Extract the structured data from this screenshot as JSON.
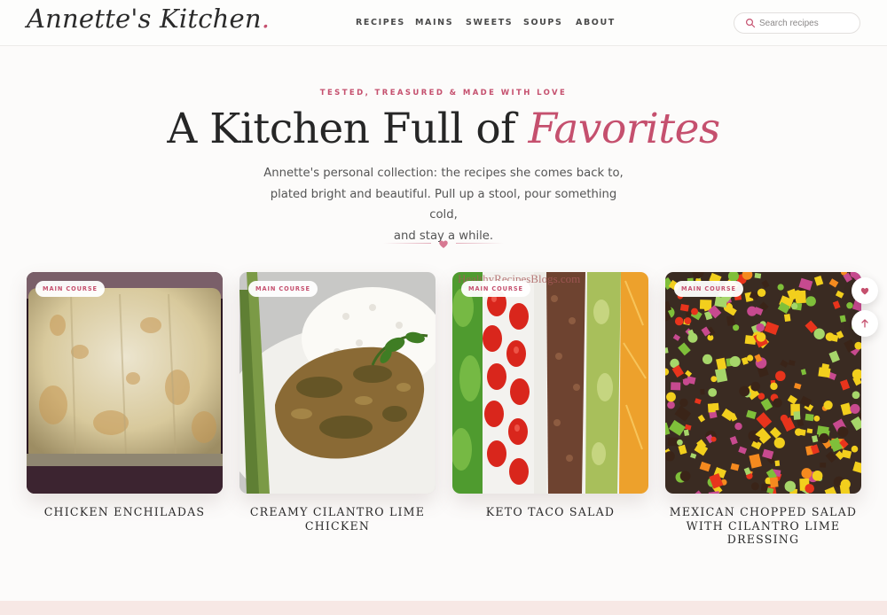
{
  "header": {
    "logo": "Annette's Kitchen",
    "logo_dot": ".",
    "nav": [
      "RECIPES",
      "MAINS",
      "SWEETS",
      "SOUPS",
      "ABOUT"
    ],
    "search_placeholder": "Search recipes"
  },
  "hero": {
    "eyebrow": "TESTED, TREASURED & MADE WITH LOVE",
    "title_main": "A Kitchen Full of ",
    "title_accent": "Favorites",
    "intro_lines": [
      "Annette's personal collection: the recipes she comes back to,",
      "plated bright and beautiful. Pull up a stool, pour something cold,",
      "and stay a while."
    ]
  },
  "recipes": [
    {
      "badge": "MAIN COURSE",
      "title_lines": [
        "CHICKEN ENCHILADAS"
      ]
    },
    {
      "badge": "MAIN COURSE",
      "title_lines": [
        "CREAMY CILANTRO LIME",
        "CHICKEN"
      ]
    },
    {
      "badge": "MAIN COURSE",
      "title_lines": [
        "KETO TACO SALAD"
      ],
      "watermark": "HealthyRecipesBlogs.com"
    },
    {
      "badge": "MAIN COURSE",
      "title_lines": [
        "MEXICAN CHOPPED SALAD",
        "WITH CILANTRO LIME",
        "DRESSING"
      ]
    }
  ],
  "icons": {
    "search": "search-icon",
    "divider": "heart-icon",
    "favorite": "heart-icon",
    "top": "arrow-up-icon"
  },
  "colors": {
    "accent": "#c5506e",
    "background": "#fcfbfa",
    "footer_band": "#f7e8e5"
  }
}
